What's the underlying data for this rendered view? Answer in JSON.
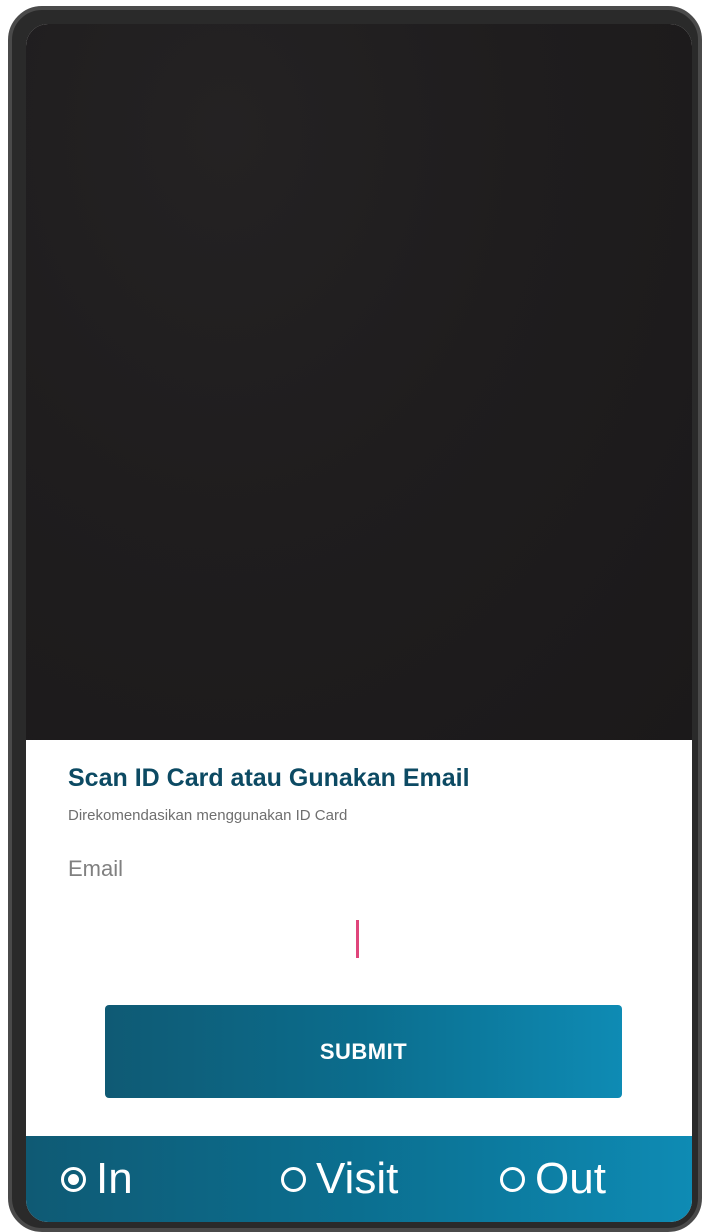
{
  "scan_panel": {
    "title": "Scan ID Card atau Gunakan Email",
    "subtitle": "Direkomendasikan menggunakan ID Card",
    "email_label": "Email",
    "email_value": "",
    "submit_label": "SUBMIT"
  },
  "mode_selector": {
    "options": [
      {
        "label": "In",
        "selected": true
      },
      {
        "label": "Visit",
        "selected": false
      },
      {
        "label": "Out",
        "selected": false
      }
    ]
  },
  "colors": {
    "title": "#0c4a63",
    "accent_gradient_start": "#0f5a74",
    "accent_gradient_end": "#0e8bb4",
    "caret": "#e0457b",
    "camera_background": "#1f1d1e"
  }
}
